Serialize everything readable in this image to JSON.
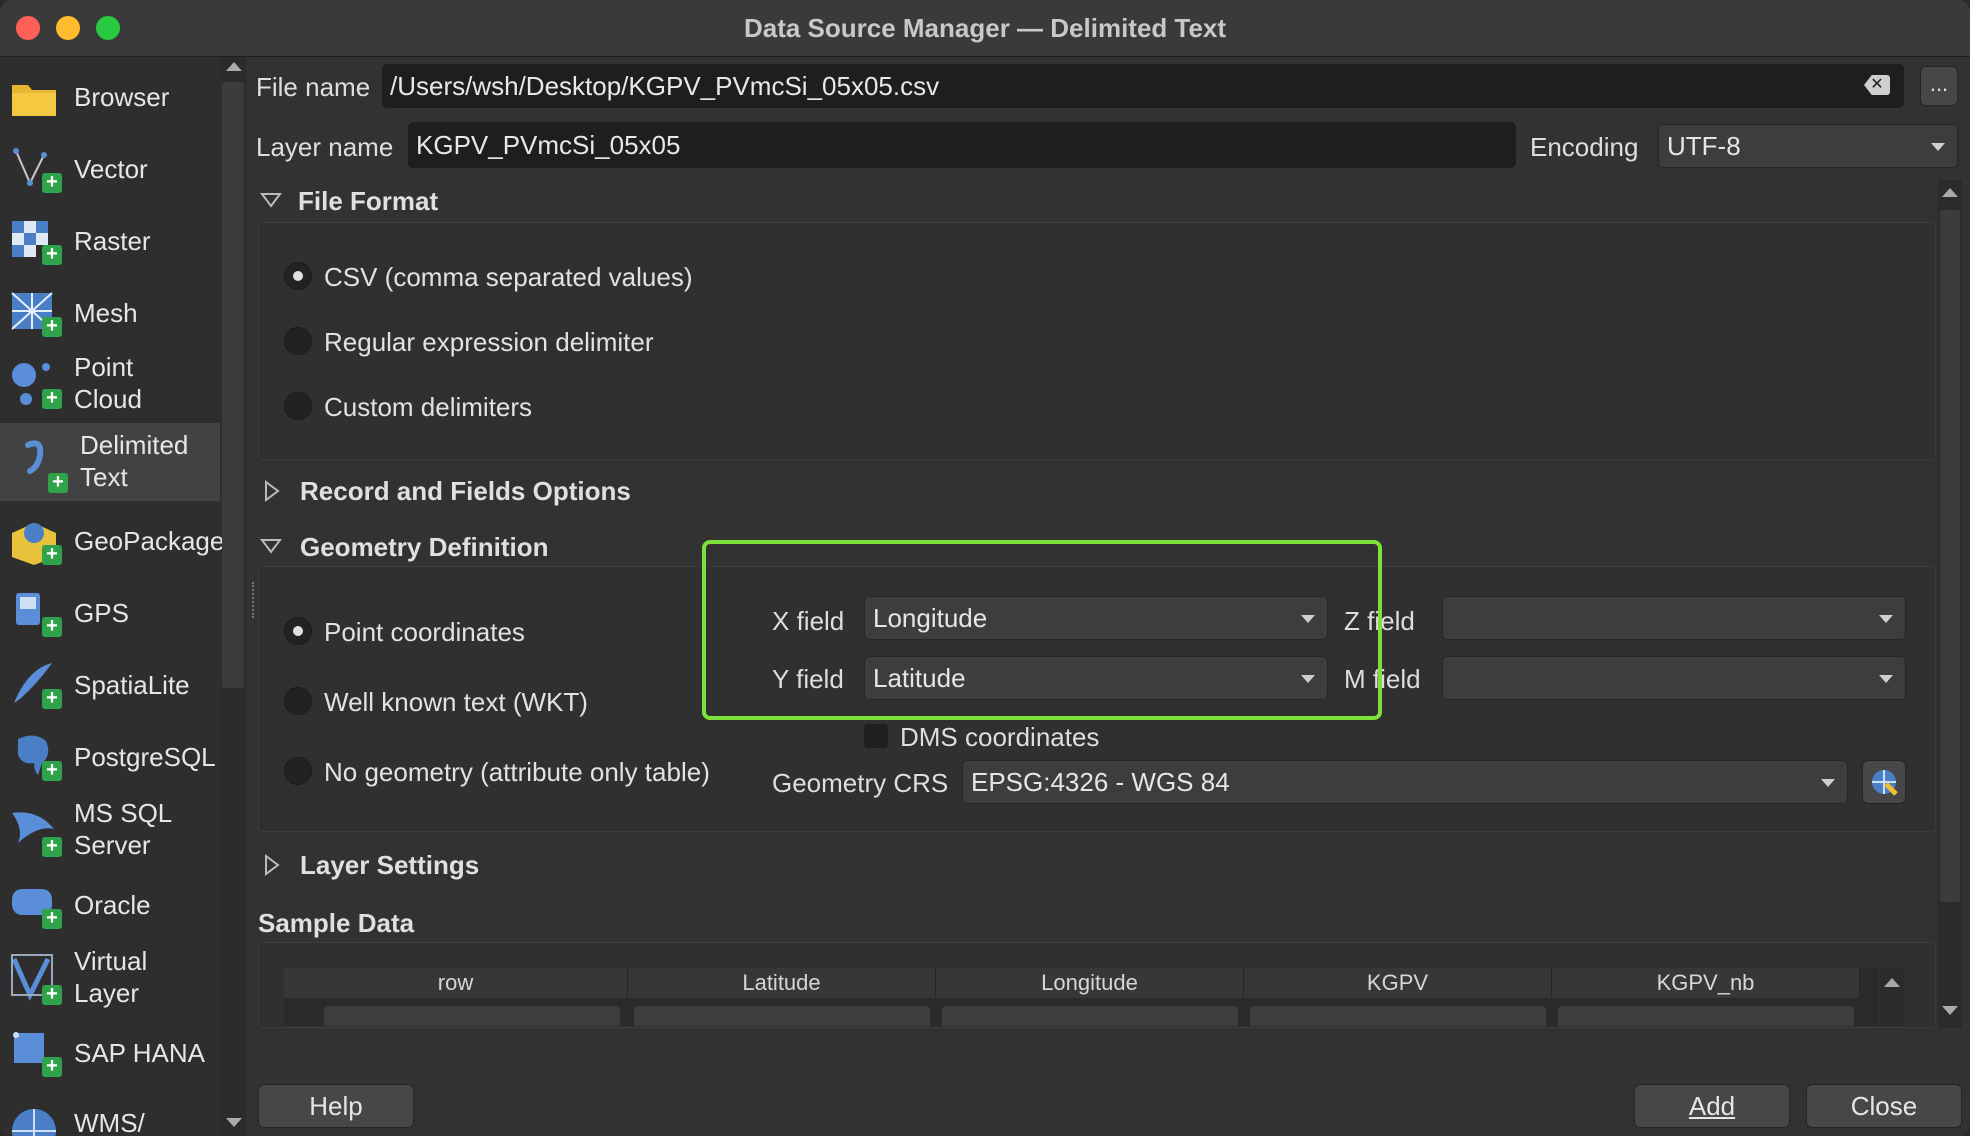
{
  "window": {
    "title": "Data Source Manager — Delimited Text"
  },
  "sidebar": {
    "items": [
      {
        "label": "Browser",
        "icon": "folder-icon"
      },
      {
        "label": "Vector",
        "icon": "vector-icon"
      },
      {
        "label": "Raster",
        "icon": "raster-icon"
      },
      {
        "label": "Mesh",
        "icon": "mesh-icon"
      },
      {
        "label": "Point",
        "label2": "Cloud",
        "icon": "point-cloud-icon"
      },
      {
        "label": "Delimited",
        "label2": "Text",
        "icon": "delimited-text-icon"
      },
      {
        "label": "GeoPackage",
        "icon": "geopackage-icon"
      },
      {
        "label": "GPS",
        "icon": "gps-icon"
      },
      {
        "label": "SpatiaLite",
        "icon": "spatialite-icon"
      },
      {
        "label": "PostgreSQL",
        "icon": "postgresql-icon"
      },
      {
        "label": "MS SQL",
        "label2": "Server",
        "icon": "mssql-icon"
      },
      {
        "label": "Oracle",
        "icon": "oracle-icon"
      },
      {
        "label": "Virtual",
        "label2": "Layer",
        "icon": "virtual-layer-icon"
      },
      {
        "label": "SAP HANA",
        "icon": "sap-hana-icon"
      },
      {
        "label": "WMS/",
        "icon": "wms-icon"
      }
    ]
  },
  "file": {
    "label": "File name",
    "value": "/Users/wsh/Desktop/KGPV_PVmcSi_05x05.csv",
    "browse_label": "..."
  },
  "layer": {
    "label": "Layer name",
    "value": "KGPV_PVmcSi_05x05",
    "encoding_label": "Encoding",
    "encoding_value": "UTF-8"
  },
  "file_format": {
    "title": "File Format",
    "options": [
      "CSV (comma separated values)",
      "Regular expression delimiter",
      "Custom delimiters"
    ],
    "selected": 0
  },
  "record_options": {
    "title": "Record and Fields Options"
  },
  "geometry": {
    "title": "Geometry Definition",
    "options": [
      "Point coordinates",
      "Well known text (WKT)",
      "No geometry (attribute only table)"
    ],
    "selected": 0,
    "x_label": "X field",
    "x_value": "Longitude",
    "y_label": "Y field",
    "y_value": "Latitude",
    "z_label": "Z field",
    "z_value": "",
    "m_label": "M field",
    "m_value": "",
    "dms_label": "DMS coordinates",
    "crs_label": "Geometry CRS",
    "crs_value": "EPSG:4326 - WGS 84",
    "highlight_color": "#7ee03a"
  },
  "layer_settings": {
    "title": "Layer Settings"
  },
  "sample": {
    "title": "Sample Data",
    "columns": [
      "row",
      "Latitude",
      "Longitude",
      "KGPV",
      "KGPV_nb"
    ]
  },
  "buttons": {
    "help": "Help",
    "add": "Add",
    "close": "Close"
  }
}
